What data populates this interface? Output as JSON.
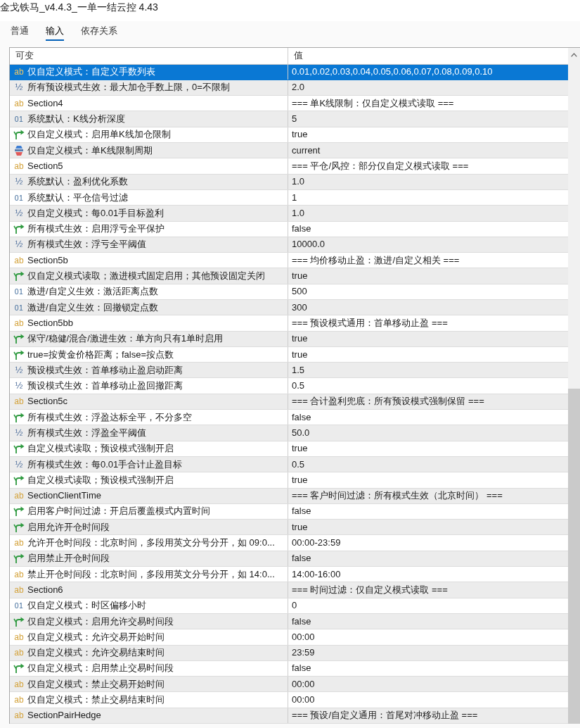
{
  "window": {
    "title": "金戈铁马_v4.4.3_一单一结云控 4.43"
  },
  "tabs": [
    {
      "label": "普通",
      "selected": false
    },
    {
      "label": "输入",
      "selected": true
    },
    {
      "label": "依存关系",
      "selected": false
    }
  ],
  "table": {
    "columns": [
      "可变",
      "值"
    ],
    "rows": [
      {
        "kind": "string",
        "icon": "ab",
        "name": "仅自定义模式：自定义手数列表",
        "value": "0.01,0.02,0.03,0.04,0.05,0.06,0.07,0.08,0.09,0.10",
        "selected": true
      },
      {
        "kind": "double",
        "icon": "½",
        "name": "所有预设模式生效：最大加仓手数上限，0=不限制",
        "value": "2.0",
        "selected": false
      },
      {
        "kind": "string",
        "icon": "ab",
        "name": "Section4",
        "value": "=== 单K线限制：仅自定义模式读取 ===",
        "selected": false
      },
      {
        "kind": "int",
        "icon": "01",
        "name": "系统默认：K线分析深度",
        "value": "5",
        "selected": false
      },
      {
        "kind": "bool",
        "name": "仅自定义模式：启用单K线加仓限制",
        "value": "true",
        "selected": false
      },
      {
        "kind": "enum",
        "name": "仅自定义模式：单K线限制周期",
        "value": "current",
        "selected": false
      },
      {
        "kind": "string",
        "icon": "ab",
        "name": "Section5",
        "value": "=== 平仓/风控：部分仅自定义模式读取 ===",
        "selected": false
      },
      {
        "kind": "double",
        "icon": "½",
        "name": "系统默认：盈利优化系数",
        "value": "1.0",
        "selected": false
      },
      {
        "kind": "int",
        "icon": "01",
        "name": "系统默认：平仓信号过滤",
        "value": "1",
        "selected": false
      },
      {
        "kind": "double",
        "icon": "½",
        "name": "仅自定义模式：每0.01手目标盈利",
        "value": "1.0",
        "selected": false
      },
      {
        "kind": "bool",
        "name": "所有模式生效：启用浮亏全平保护",
        "value": "false",
        "selected": false
      },
      {
        "kind": "double",
        "icon": "½",
        "name": "所有模式生效：浮亏全平阈值",
        "value": "10000.0",
        "selected": false
      },
      {
        "kind": "string",
        "icon": "ab",
        "name": "Section5b",
        "value": "=== 均价移动止盈：激进/自定义相关 ===",
        "selected": false
      },
      {
        "kind": "bool",
        "name": "仅自定义模式读取；激进模式固定启用；其他预设固定关闭",
        "value": "true",
        "selected": false
      },
      {
        "kind": "int",
        "icon": "01",
        "name": "激进/自定义生效：激活距离点数",
        "value": "500",
        "selected": false
      },
      {
        "kind": "int",
        "icon": "01",
        "name": "激进/自定义生效：回撤锁定点数",
        "value": "300",
        "selected": false
      },
      {
        "kind": "string",
        "icon": "ab",
        "name": "Section5bb",
        "value": "=== 预设模式通用：首单移动止盈 ===",
        "selected": false
      },
      {
        "kind": "bool",
        "name": "保守/稳健/混合/激进生效：单方向只有1单时启用",
        "value": "true",
        "selected": false
      },
      {
        "kind": "bool",
        "name": "true=按黄金价格距离；false=按点数",
        "value": "true",
        "selected": false
      },
      {
        "kind": "double",
        "icon": "½",
        "name": "预设模式生效：首单移动止盈启动距离",
        "value": "1.5",
        "selected": false
      },
      {
        "kind": "double",
        "icon": "½",
        "name": "预设模式生效：首单移动止盈回撤距离",
        "value": "0.5",
        "selected": false
      },
      {
        "kind": "string",
        "icon": "ab",
        "name": "Section5c",
        "value": "=== 合计盈利兜底：所有预设模式强制保留 ===",
        "selected": false
      },
      {
        "kind": "bool",
        "name": "所有模式生效：浮盈达标全平，不分多空",
        "value": "false",
        "selected": false
      },
      {
        "kind": "double",
        "icon": "½",
        "name": "所有模式生效：浮盈全平阈值",
        "value": "50.0",
        "selected": false
      },
      {
        "kind": "bool",
        "name": "自定义模式读取；预设模式强制开启",
        "value": "true",
        "selected": false
      },
      {
        "kind": "double",
        "icon": "½",
        "name": "所有模式生效：每0.01手合计止盈目标",
        "value": "0.5",
        "selected": false
      },
      {
        "kind": "bool",
        "name": "自定义模式读取；预设模式强制开启",
        "value": "true",
        "selected": false
      },
      {
        "kind": "string",
        "icon": "ab",
        "name": "SectionClientTime",
        "value": "=== 客户时间过滤：所有模式生效（北京时间） ===",
        "selected": false
      },
      {
        "kind": "bool",
        "name": "启用客户时间过滤：开启后覆盖模式内置时间",
        "value": "false",
        "selected": false
      },
      {
        "kind": "bool",
        "name": "启用允许开仓时间段",
        "value": "true",
        "selected": false
      },
      {
        "kind": "string",
        "icon": "ab",
        "name": "允许开仓时间段：北京时间，多段用英文分号分开，如 09:0...",
        "value": "00:00-23:59",
        "selected": false
      },
      {
        "kind": "bool",
        "name": "启用禁止开仓时间段",
        "value": "false",
        "selected": false
      },
      {
        "kind": "string",
        "icon": "ab",
        "name": "禁止开仓时间段：北京时间，多段用英文分号分开，如 14:0...",
        "value": "14:00-16:00",
        "selected": false
      },
      {
        "kind": "string",
        "icon": "ab",
        "name": "Section6",
        "value": "=== 时间过滤：仅自定义模式读取 ===",
        "selected": false
      },
      {
        "kind": "int",
        "icon": "01",
        "name": "仅自定义模式：时区偏移小时",
        "value": "0",
        "selected": false
      },
      {
        "kind": "bool",
        "name": "仅自定义模式：启用允许交易时间段",
        "value": "false",
        "selected": false
      },
      {
        "kind": "string",
        "icon": "ab",
        "name": "仅自定义模式：允许交易开始时间",
        "value": "00:00",
        "selected": false
      },
      {
        "kind": "string",
        "icon": "ab",
        "name": "仅自定义模式：允许交易结束时间",
        "value": "23:59",
        "selected": false
      },
      {
        "kind": "bool",
        "name": "仅自定义模式：启用禁止交易时间段",
        "value": "false",
        "selected": false
      },
      {
        "kind": "string",
        "icon": "ab",
        "name": "仅自定义模式：禁止交易开始时间",
        "value": "00:00",
        "selected": false
      },
      {
        "kind": "string",
        "icon": "ab",
        "name": "仅自定义模式：禁止交易结束时间",
        "value": "00:00",
        "selected": false
      },
      {
        "kind": "string",
        "icon": "ab",
        "name": "SectionPairHedge",
        "value": "=== 预设/自定义通用：首尾对冲移动止盈 ===",
        "selected": false
      }
    ]
  }
}
